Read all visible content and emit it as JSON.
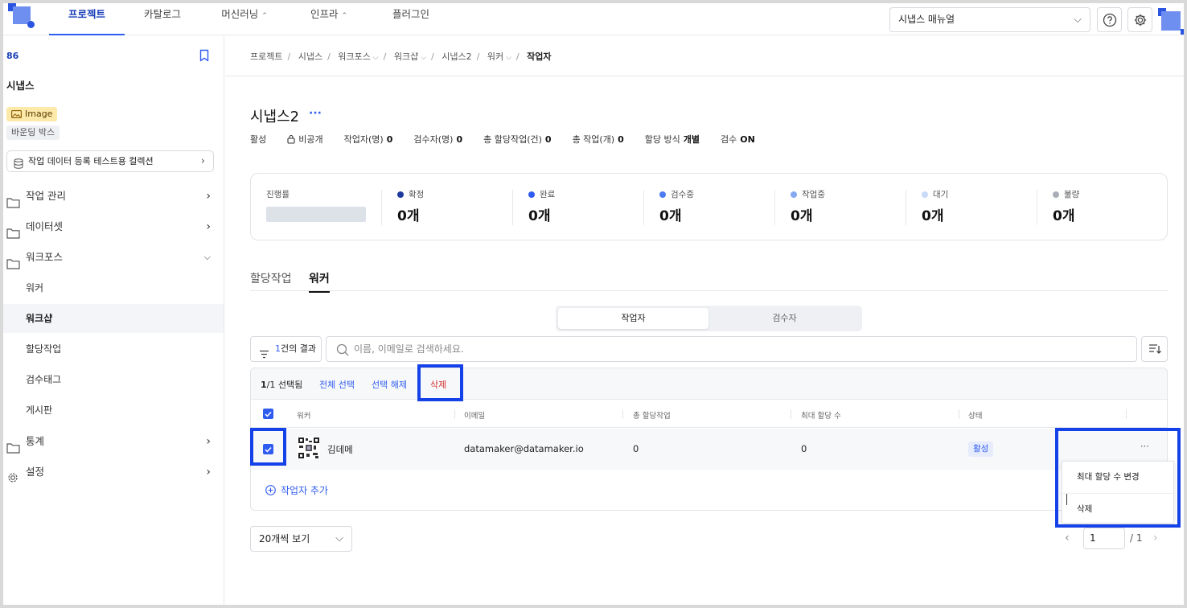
{
  "topnav": {
    "tabs": [
      {
        "label": "프로젝트"
      },
      {
        "label": "카탈로그"
      },
      {
        "label": "머신러닝"
      },
      {
        "label": "인프라"
      },
      {
        "label": "플러그인"
      }
    ],
    "manual_select": "시냅스 매뉴얼"
  },
  "sidebar": {
    "project_id": "86",
    "project_name": "시냅스",
    "tag_type": "Image",
    "tag_annotation": "바운딩 박스",
    "collection": "작업 데이터 등록 테스트용 컬렉션",
    "menu": {
      "task_mgmt": "작업 관리",
      "dataset": "데이터셋",
      "workforce": "워크포스",
      "workers": "워커",
      "workshop": "워크샵",
      "assignments": "할당작업",
      "review_tags": "검수태그",
      "board": "게시판",
      "stats": "통계",
      "settings": "설정"
    }
  },
  "breadcrumb": [
    "프로젝트",
    "시냅스",
    "워크포스",
    "워크샵",
    "시냅스2",
    "워커",
    "작업자"
  ],
  "page": {
    "title": "시냅스2",
    "more": "···",
    "meta": {
      "status": "활성",
      "visibility": "비공개",
      "workers_label": "작업자(명)",
      "workers_value": "0",
      "reviewers_label": "검수자(명)",
      "reviewers_value": "0",
      "assigned_label": "총 할당작업(건)",
      "assigned_value": "0",
      "tasks_label": "총 작업(개)",
      "tasks_value": "0",
      "method_label": "할당 방식",
      "method_value": "개별",
      "review_label": "검수",
      "review_value": "ON"
    }
  },
  "stats": {
    "progress_label": "진행률",
    "items": [
      {
        "label": "확정",
        "value": "0개",
        "color": "#1e3a9e"
      },
      {
        "label": "완료",
        "value": "0개",
        "color": "#2f5cf0"
      },
      {
        "label": "검수중",
        "value": "0개",
        "color": "#4a7bf0"
      },
      {
        "label": "작업중",
        "value": "0개",
        "color": "#86a9f3"
      },
      {
        "label": "대기",
        "value": "0개",
        "color": "#c8daf8"
      },
      {
        "label": "불량",
        "value": "0개",
        "color": "#a9adb5"
      }
    ]
  },
  "tabs": {
    "assignments": "할당작업",
    "workers": "워커"
  },
  "segment": {
    "workers": "작업자",
    "reviewers": "검수자"
  },
  "toolbar": {
    "result_count": "1",
    "result_suffix": "건의 결과",
    "search_placeholder": "이름, 이메일로 검색하세요."
  },
  "table": {
    "selection": {
      "count": "1",
      "total": "/1",
      "suffix": "선택됨",
      "select_all": "전체 선택",
      "deselect": "선택 해제",
      "delete": "삭제"
    },
    "headers": {
      "worker": "워커",
      "email": "이메일",
      "assigned": "총 할당작업",
      "max_assign": "최대 할당 수",
      "status": "상태"
    },
    "rows": [
      {
        "name": "김데메",
        "email": "datamaker@datamaker.io",
        "assigned": "0",
        "max_assign": "0",
        "status": "활성",
        "selected": true
      }
    ],
    "add_worker": "작업자 추가",
    "row_menu": [
      "최대 할당 수 변경",
      "삭제"
    ],
    "row_more": "···"
  },
  "footer": {
    "per_page": "20개씩 보기",
    "page_current": "1",
    "page_total": "/ 1"
  },
  "colors": {
    "accent": "#2f5cf0",
    "highlight": "#1442e8",
    "danger": "#d32f2f"
  }
}
